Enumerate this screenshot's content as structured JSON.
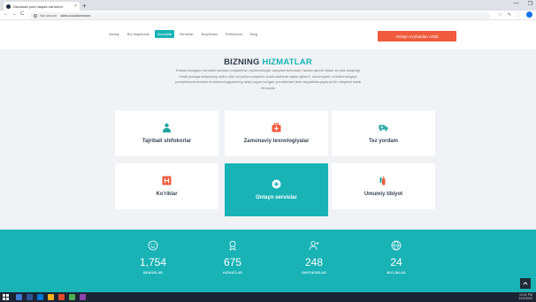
{
  "browser": {
    "tab_title": "Davolash yurti haqida ma'lumot",
    "tab_close": "×",
    "new_tab": "+",
    "security_label": "Not secure",
    "url": "clinic.local/services",
    "nav_back": "←",
    "nav_forward": "→",
    "nav_reload": "C",
    "window_min": "—",
    "window_max": "❐"
  },
  "site": {
    "menu": [
      "Asosiy",
      "Biz haqimizda",
      "Xizmatlar",
      "Bo'limlar",
      "Bog'lanish",
      "Shifokorlar",
      "Blog"
    ],
    "active_index": 2,
    "cta": "Onlayn ro'yhatdan o'tish"
  },
  "services": {
    "title_main": "BIZNING",
    "title_accent": "HIZMATLAR",
    "description": "Endokrinologiya xizmatini yanada rivojlantirish epidemiologik vaziyatni baholash hamda qandli diabet va yod tanqisligi holati yuzaga kelishining oldini olish bo'yicha kompleks chora-tadbirlar qabul qilishni, shuningdek, endokrinologiya yo'nalishlarini bolalar endokrinologiyasining talab paydo bo'lgan yo'nalishlari bilan birgalikda qayta ko'rib chiqishni talab etmoqda",
    "cards": [
      {
        "label": "Tajribali shifokorlar",
        "icon": "doctor-icon"
      },
      {
        "label": "Zamonaviy texnologiyalar",
        "icon": "medkit-icon"
      },
      {
        "label": "Tez yordam",
        "icon": "ambulance-icon"
      },
      {
        "label": "Ko'riklar",
        "icon": "hospital-icon"
      },
      {
        "label": "Onlayn servislar",
        "icon": "plus-circle-icon"
      },
      {
        "label": "Umumiy tibiyot",
        "icon": "syringe-icon"
      }
    ]
  },
  "stats": [
    {
      "value": "1,754",
      "caption": "BEMORLAR",
      "icon": "smile-icon"
    },
    {
      "value": "675",
      "caption": "HIZMATLAR",
      "icon": "award-icon"
    },
    {
      "value": "248",
      "caption": "SHIFOKORLAR",
      "icon": "user-add-icon"
    },
    {
      "value": "24",
      "caption": "BO'LIMLAR",
      "icon": "globe-icon"
    }
  ],
  "taskbar": {
    "time": "10:41 PM",
    "date": "12/3/2020"
  },
  "colors": {
    "teal": "#19b3b6",
    "orange": "#ef5b3c",
    "icon_teal": "#22a59e"
  }
}
